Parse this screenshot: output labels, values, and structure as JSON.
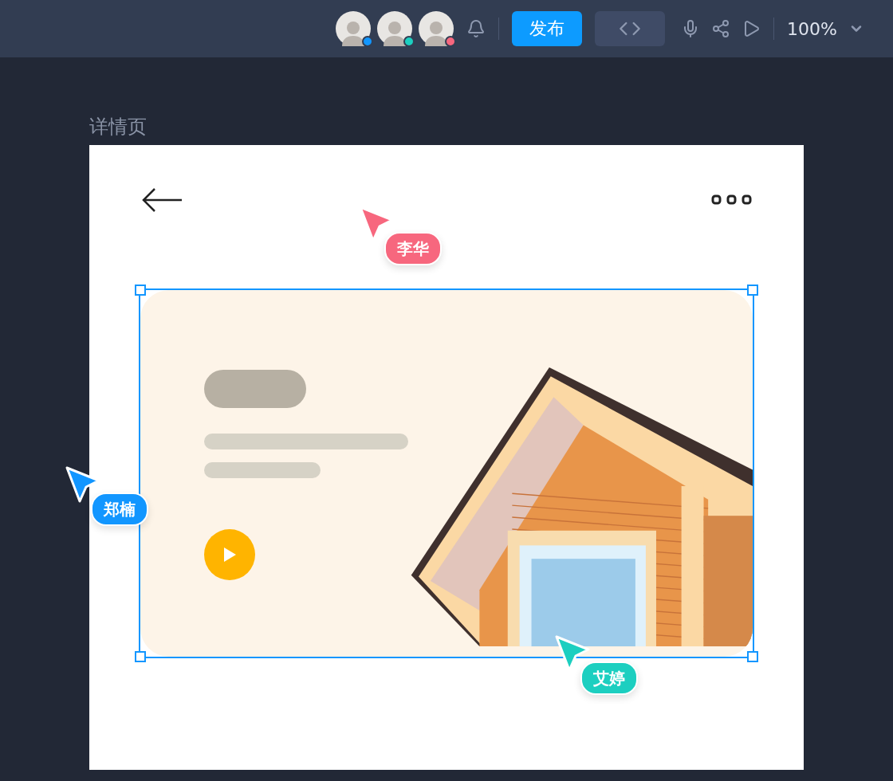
{
  "toolbar": {
    "collaborators": [
      {
        "color": "#1296ff"
      },
      {
        "color": "#1ccfc0"
      },
      {
        "color": "#f7677e"
      }
    ],
    "publish_button": "发布",
    "zoom": "100%"
  },
  "page": {
    "title": "详情页",
    "card": {
      "selected": true
    },
    "cursors": [
      {
        "name": "李华",
        "color": "#f7677e"
      },
      {
        "name": "郑楠",
        "color": "#1296ff"
      },
      {
        "name": "艾婷",
        "color": "#1ccfc0"
      }
    ]
  }
}
